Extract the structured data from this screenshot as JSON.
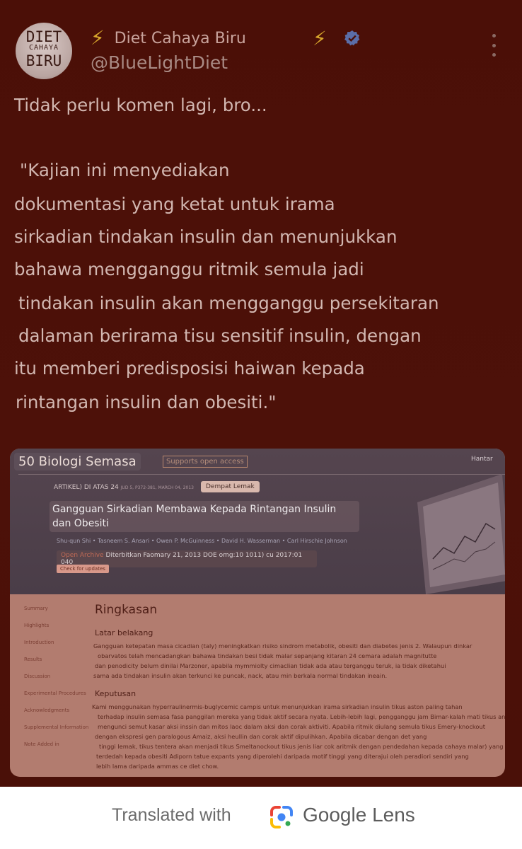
{
  "author": {
    "avatar_line1": "DIET",
    "avatar_line2": "CAHAYA",
    "avatar_line3": "BIRU",
    "name": "Diet Cahaya Biru",
    "handle": "@BlueLightDiet",
    "bolt_glyph": "⚡"
  },
  "tweet": {
    "lines": [
      "Tidak perlu komen lagi, bro...",
      "\"Kajian ini menyediakan",
      "dokumentasi yang ketat untuk irama",
      "sirkadian tindakan insulin dan menunjukkan",
      "bahawa mengganggu ritmik semula jadi",
      "tindakan insulin akan mengganggu persekitaran",
      "dalaman berirama tisu sensitif insulin, dengan",
      "itu memberi predisposisi haiwan kepada",
      "rintangan insulin dan obesiti.\""
    ]
  },
  "image": {
    "journal": "50 Biologi Semasa",
    "open_access_box": "Supports open access",
    "send": "Hantar",
    "article_meta": "ARTIKEL) DI ATAS 24",
    "article_meta_small": "JUD 5, P372-381, MARCH 04, 2013",
    "tag_button": "Dempat Lemak",
    "title": "Gangguan Sirkadian Membawa Kepada Rintangan Insulin dan Obesiti",
    "authors": "Shu-qun Shi • Tasneem S. Ansari • Owen P. McGuinness • David H. Wasserman • Carl Hirschie Johnson",
    "pub_label": "Open Archive",
    "published": "Diterbitkan Faomary 21, 2013 DOE omg:10 1011) cu 2017:01 040",
    "check_updates": "Check for updates",
    "side_nav": [
      "Summary",
      "Highlights",
      "Introduction",
      "Results",
      "Discussion",
      "Experimental Procedures",
      "Acknowledgments",
      "Supplemental Information",
      "Note Added in"
    ],
    "heading": "Ringkasan",
    "section1": "Latar belakang",
    "para1": [
      "Gangguan ketepatan masa cicadian (taly) meningkatkan risiko sindrom metabolik, obesiti dan diabetes jenis 2. Walaupun dinkar",
      "obarvatos telah mencadangkan bahawa tindakan besi tidak malar sepanjang kitaran 24 cemara adalah magnitutte",
      "dan penodicity belum dinilai Marzoner, apabila mymmiolty cimaclian tidak ada atau terganggu teruk, ia tidak diketahui",
      "sama ada tindakan insulin akan terkunci ke puncak, nack, atau min berkala normal tindakan ineain."
    ],
    "section2": "Keputusan",
    "para2": [
      "Kami menggunakan hyperraulinermis-buglycemic campis untuk menunjukkan irama sirkadian insulin tikus aston paling tahan",
      "terhadap insulin semasa fasa panggilan mereka yang tidak aktif secara nyata. Lebih-lebih lagi, pengganggu jam Bimar-kalah mati tikus ane",
      "mengunci semut kasar aksi inssin dan mitos laoc dalam aksi dan corak aktiviti. Apabila ritmik diulang semula tikus Emery-knockout",
      "dengan ekspresi gen paralogous Amaiz, aksi heullin dan corak aktif dipulihkan. Apabila dicabar dengan det yang",
      "tinggi lemak, tikus tentera akan menjadi tikus Smeltanockout tikus jenis liar cok aritmik dengan pendedahan kepada cahaya malar) yang",
      "terdedah kepada obesiti Adiporn tatue expants yang diperolehi daripada motif tinggi yang diterajui oleh peradiori sendiri yang",
      "lebih lama daripada ammas ce diet chow."
    ]
  },
  "footer": {
    "translated_with": "Translated with",
    "google_lens": "Google Lens"
  },
  "colors": {
    "background": "#4a0e06",
    "bolt": "#d8a62c",
    "verified": "#5b6ea8"
  },
  "icons": [
    "lightning-bolt-icon",
    "verified-badge-icon",
    "more-options-icon",
    "google-lens-icon"
  ]
}
